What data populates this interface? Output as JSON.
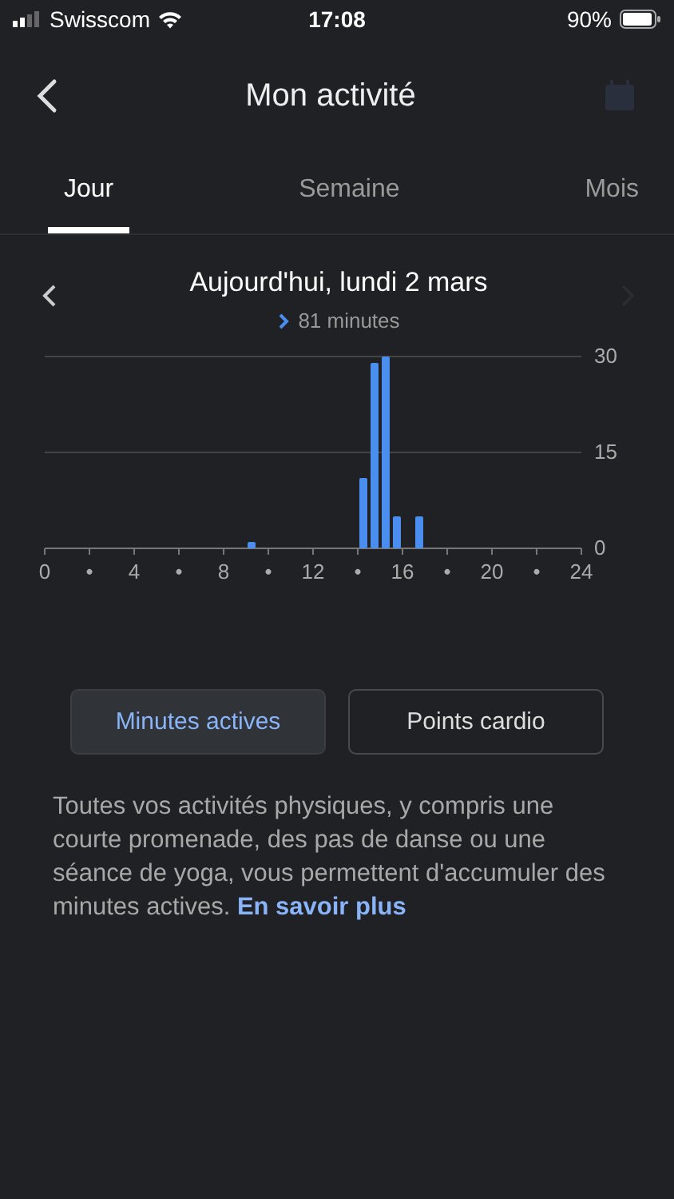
{
  "status_bar": {
    "carrier": "Swisscom",
    "time": "17:08",
    "battery": "90%"
  },
  "header": {
    "title": "Mon activité",
    "calendar_disabled": true
  },
  "tabs": [
    {
      "label": "Jour",
      "selected": true
    },
    {
      "label": "Semaine",
      "selected": false
    },
    {
      "label": "Mois",
      "selected": false
    }
  ],
  "date_nav": {
    "title": "Aujourd'hui, lundi 2 mars",
    "summary": "81 minutes",
    "prev_disabled": false,
    "next_disabled": true
  },
  "chart_data": {
    "type": "bar",
    "x": [
      9.25,
      14.25,
      14.75,
      15.25,
      15.75,
      16.75
    ],
    "series": [
      {
        "color": "#4a8ef0",
        "values": [
          1,
          11,
          29,
          30,
          5,
          5
        ]
      }
    ],
    "xlim": [
      0,
      24
    ],
    "ylim": [
      0,
      30
    ],
    "yticks": [
      0,
      15,
      30
    ],
    "xticks": [
      {
        "value": 0,
        "label": "0"
      },
      {
        "value": 2,
        "label": "•"
      },
      {
        "value": 4,
        "label": "4"
      },
      {
        "value": 6,
        "label": "•"
      },
      {
        "value": 8,
        "label": "8"
      },
      {
        "value": 10,
        "label": "•"
      },
      {
        "value": 12,
        "label": "12"
      },
      {
        "value": 14,
        "label": "•"
      },
      {
        "value": 16,
        "label": "16"
      },
      {
        "value": 18,
        "label": "•"
      },
      {
        "value": 20,
        "label": "20"
      },
      {
        "value": 22,
        "label": "•"
      },
      {
        "value": 24,
        "label": "24"
      }
    ]
  },
  "metric_buttons": [
    {
      "label": "Minutes actives",
      "selected": true
    },
    {
      "label": "Points cardio",
      "selected": false
    }
  ],
  "description": "Toutes vos activités physiques, y compris une courte promenade, des pas de danse ou une séance de yoga, vous permettent d'accumuler des minutes actives.",
  "link": "En savoir plus"
}
